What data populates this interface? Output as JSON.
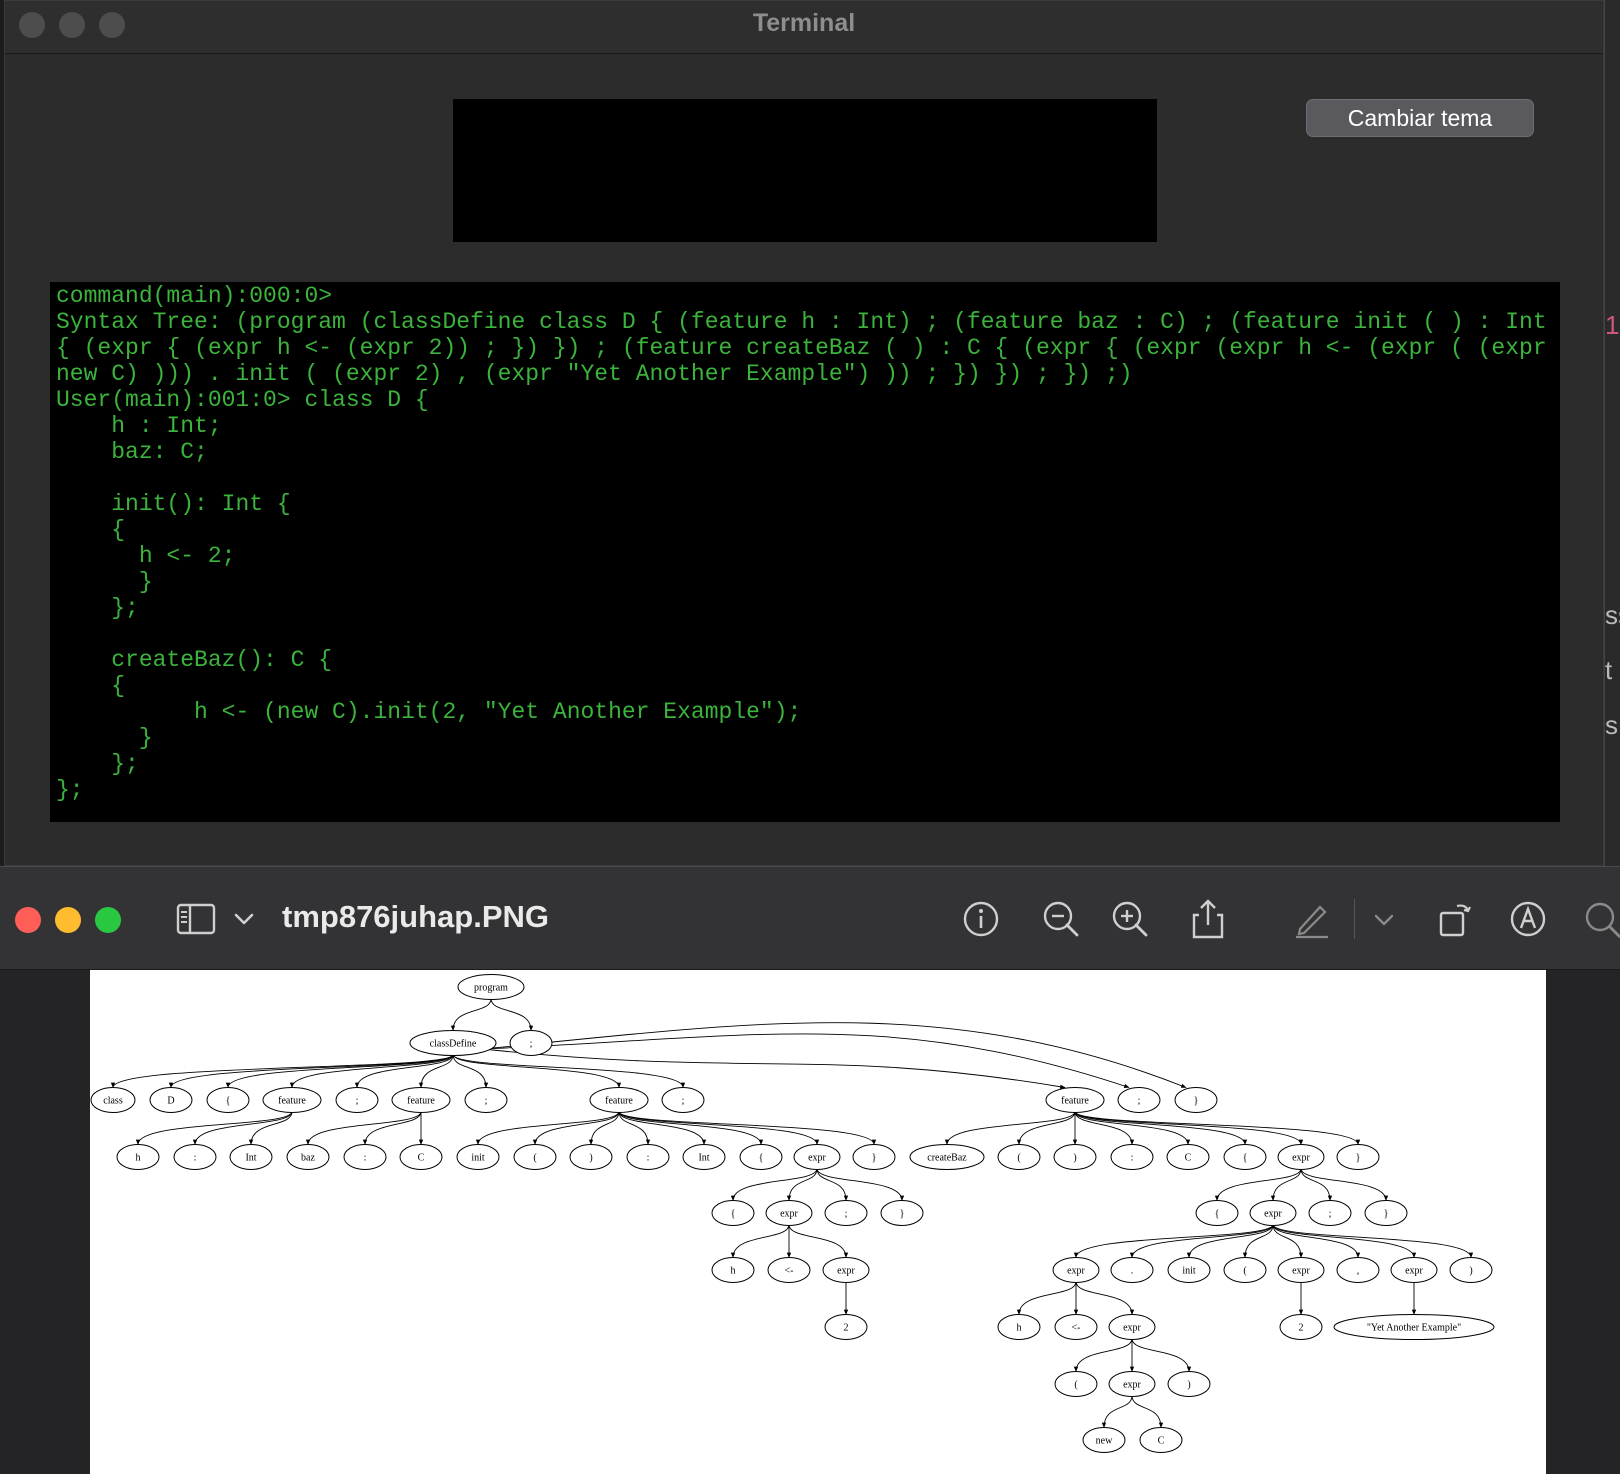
{
  "terminal": {
    "title": "Terminal",
    "theme_button_label": "Cambiar tema",
    "console_lines": [
      "command(main):000:0>",
      "Syntax Tree: (program (classDefine class D { (feature h : Int) ; (feature baz : C) ; (feature init ( ) : Int { (expr { (expr h <- (expr 2)) ; }) }) ; (feature createBaz ( ) : C { (expr { (expr (expr h <- (expr ( (expr new C) ))) . init ( (expr 2) , (expr \"Yet Another Example\") )) ; }) }) ; }) ;)",
      "User(main):001:0> class D {",
      "    h : Int;",
      "    baz: C;",
      "",
      "    init(): Int {",
      "    {",
      "      h <- 2;",
      "      }",
      "    };",
      "",
      "    createBaz(): C {",
      "    {",
      "          h <- (new C).init(2, \"Yet Another Example\");",
      "      }",
      "    };",
      "};"
    ]
  },
  "background_window": {
    "glyphs": [
      "1",
      "ss",
      "t",
      "s"
    ]
  },
  "preview": {
    "file_name": "tmp876juhap.PNG",
    "traffic_colors": [
      "#ff5f57",
      "#febc2e",
      "#28c840"
    ],
    "toolbar_icons": [
      "sidebar-toggle-icon",
      "chevron-down-icon",
      "info-icon",
      "zoom-out-icon",
      "zoom-in-icon",
      "share-icon",
      "markup-pen-icon",
      "chevron-down-icon",
      "rotate-icon",
      "markup-circle-icon",
      "search-icon"
    ]
  },
  "tree": {
    "nodes": [
      {
        "id": "program",
        "label": "program"
      },
      {
        "id": "classDefine",
        "label": "classDefine"
      },
      {
        "id": "semi_top",
        "label": ";"
      },
      {
        "id": "class",
        "label": "class"
      },
      {
        "id": "D",
        "label": "D"
      },
      {
        "id": "lb1",
        "label": "{"
      },
      {
        "id": "f1",
        "label": "feature"
      },
      {
        "id": "s1",
        "label": ";"
      },
      {
        "id": "f2",
        "label": "feature"
      },
      {
        "id": "s2",
        "label": ";"
      },
      {
        "id": "f3",
        "label": "feature"
      },
      {
        "id": "s3",
        "label": ";"
      },
      {
        "id": "f4",
        "label": "feature"
      },
      {
        "id": "s4",
        "label": ";"
      },
      {
        "id": "rb1",
        "label": "}"
      },
      {
        "id": "f1_h",
        "label": "h"
      },
      {
        "id": "f1_c",
        "label": ":"
      },
      {
        "id": "f1_int",
        "label": "Int"
      },
      {
        "id": "f2_baz",
        "label": "baz"
      },
      {
        "id": "f2_c",
        "label": ":"
      },
      {
        "id": "f2_C",
        "label": "C"
      },
      {
        "id": "f3_init",
        "label": "init"
      },
      {
        "id": "f3_lp",
        "label": "("
      },
      {
        "id": "f3_rp",
        "label": ")"
      },
      {
        "id": "f3_c",
        "label": ":"
      },
      {
        "id": "f3_int",
        "label": "Int"
      },
      {
        "id": "f3_lb",
        "label": "{"
      },
      {
        "id": "f3_expr",
        "label": "expr"
      },
      {
        "id": "f3_rb",
        "label": "}"
      },
      {
        "id": "e1_lb",
        "label": "{"
      },
      {
        "id": "e1_expr",
        "label": "expr"
      },
      {
        "id": "e1_s",
        "label": ";"
      },
      {
        "id": "e1_rb",
        "label": "}"
      },
      {
        "id": "e2_h",
        "label": "h"
      },
      {
        "id": "e2_arrow",
        "label": "<-"
      },
      {
        "id": "e2_expr",
        "label": "expr"
      },
      {
        "id": "e3_2",
        "label": "2"
      },
      {
        "id": "f4_name",
        "label": "createBaz"
      },
      {
        "id": "f4_lp",
        "label": "("
      },
      {
        "id": "f4_rp",
        "label": ")"
      },
      {
        "id": "f4_c",
        "label": ":"
      },
      {
        "id": "f4_C",
        "label": "C"
      },
      {
        "id": "f4_lb",
        "label": "{"
      },
      {
        "id": "f4_expr",
        "label": "expr"
      },
      {
        "id": "f4_rb",
        "label": "}"
      },
      {
        "id": "g1_lb",
        "label": "{"
      },
      {
        "id": "g1_expr",
        "label": "expr"
      },
      {
        "id": "g1_s",
        "label": ";"
      },
      {
        "id": "g1_rb",
        "label": "}"
      },
      {
        "id": "g2_expr",
        "label": "expr"
      },
      {
        "id": "g2_dot",
        "label": "."
      },
      {
        "id": "g2_init",
        "label": "init"
      },
      {
        "id": "g2_lp",
        "label": "("
      },
      {
        "id": "g2_e2",
        "label": "expr"
      },
      {
        "id": "g2_comma",
        "label": ","
      },
      {
        "id": "g2_e3",
        "label": "expr"
      },
      {
        "id": "g2_rp",
        "label": ")"
      },
      {
        "id": "g3_h",
        "label": "h"
      },
      {
        "id": "g3_arrow",
        "label": "<-"
      },
      {
        "id": "g3_expr",
        "label": "expr"
      },
      {
        "id": "g2_2",
        "label": "2"
      },
      {
        "id": "g2_str",
        "label": "\"Yet Another Example\""
      },
      {
        "id": "g4_lp",
        "label": "("
      },
      {
        "id": "g4_expr",
        "label": "expr"
      },
      {
        "id": "g4_rp",
        "label": ")"
      },
      {
        "id": "g5_new",
        "label": "new"
      },
      {
        "id": "g5_C",
        "label": "C"
      }
    ],
    "edges": [
      [
        "program",
        "classDefine"
      ],
      [
        "program",
        "semi_top"
      ],
      [
        "classDefine",
        "class"
      ],
      [
        "classDefine",
        "D"
      ],
      [
        "classDefine",
        "lb1"
      ],
      [
        "classDefine",
        "f1"
      ],
      [
        "classDefine",
        "s1"
      ],
      [
        "classDefine",
        "f2"
      ],
      [
        "classDefine",
        "s2"
      ],
      [
        "classDefine",
        "f3"
      ],
      [
        "classDefine",
        "s3"
      ],
      [
        "classDefine",
        "f4"
      ],
      [
        "classDefine",
        "s4"
      ],
      [
        "classDefine",
        "rb1"
      ],
      [
        "f1",
        "f1_h"
      ],
      [
        "f1",
        "f1_c"
      ],
      [
        "f1",
        "f1_int"
      ],
      [
        "f2",
        "f2_baz"
      ],
      [
        "f2",
        "f2_c"
      ],
      [
        "f2",
        "f2_C"
      ],
      [
        "f3",
        "f3_init"
      ],
      [
        "f3",
        "f3_lp"
      ],
      [
        "f3",
        "f3_rp"
      ],
      [
        "f3",
        "f3_c"
      ],
      [
        "f3",
        "f3_int"
      ],
      [
        "f3",
        "f3_lb"
      ],
      [
        "f3",
        "f3_expr"
      ],
      [
        "f3",
        "f3_rb"
      ],
      [
        "f3_expr",
        "e1_lb"
      ],
      [
        "f3_expr",
        "e1_expr"
      ],
      [
        "f3_expr",
        "e1_s"
      ],
      [
        "f3_expr",
        "e1_rb"
      ],
      [
        "e1_expr",
        "e2_h"
      ],
      [
        "e1_expr",
        "e2_arrow"
      ],
      [
        "e1_expr",
        "e2_expr"
      ],
      [
        "e2_expr",
        "e3_2"
      ],
      [
        "f4",
        "f4_name"
      ],
      [
        "f4",
        "f4_lp"
      ],
      [
        "f4",
        "f4_rp"
      ],
      [
        "f4",
        "f4_c"
      ],
      [
        "f4",
        "f4_C"
      ],
      [
        "f4",
        "f4_lb"
      ],
      [
        "f4",
        "f4_expr"
      ],
      [
        "f4",
        "f4_rb"
      ],
      [
        "f4_expr",
        "g1_lb"
      ],
      [
        "f4_expr",
        "g1_expr"
      ],
      [
        "f4_expr",
        "g1_s"
      ],
      [
        "f4_expr",
        "g1_rb"
      ],
      [
        "g1_expr",
        "g2_expr"
      ],
      [
        "g1_expr",
        "g2_dot"
      ],
      [
        "g1_expr",
        "g2_init"
      ],
      [
        "g1_expr",
        "g2_lp"
      ],
      [
        "g1_expr",
        "g2_e2"
      ],
      [
        "g1_expr",
        "g2_comma"
      ],
      [
        "g1_expr",
        "g2_e3"
      ],
      [
        "g1_expr",
        "g2_rp"
      ],
      [
        "g2_expr",
        "g3_h"
      ],
      [
        "g2_expr",
        "g3_arrow"
      ],
      [
        "g2_expr",
        "g3_expr"
      ],
      [
        "g2_e2",
        "g2_2"
      ],
      [
        "g2_e3",
        "g2_str"
      ],
      [
        "g3_expr",
        "g4_lp"
      ],
      [
        "g3_expr",
        "g4_expr"
      ],
      [
        "g3_expr",
        "g4_rp"
      ],
      [
        "g4_expr",
        "g5_new"
      ],
      [
        "g4_expr",
        "g5_C"
      ]
    ]
  }
}
